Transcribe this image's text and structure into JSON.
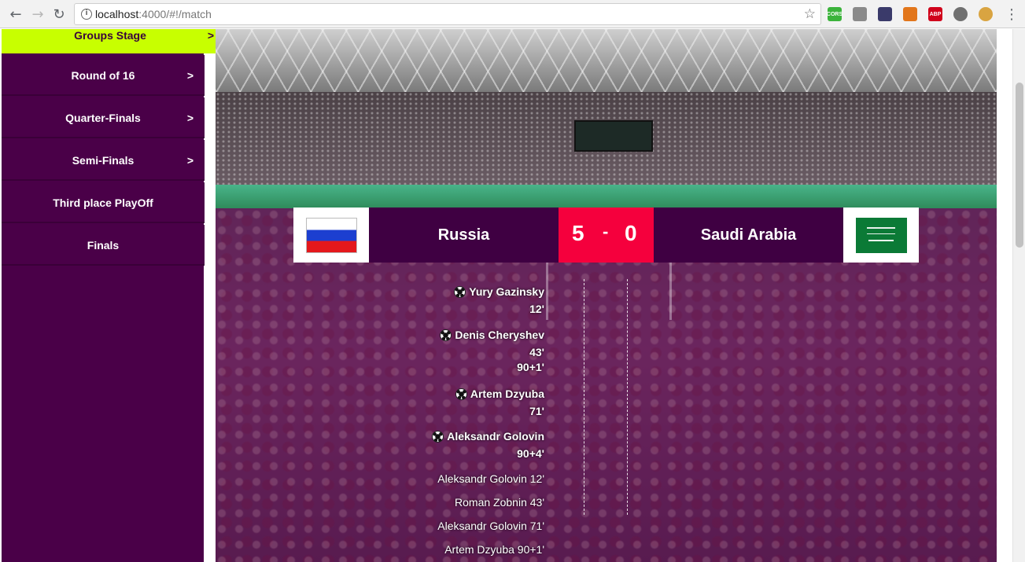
{
  "browser": {
    "url_host": "localhost",
    "url_path": ":4000/#!/match",
    "extensions": [
      {
        "name": "cors-icon",
        "text": "CORS",
        "color": "#3bb33b"
      },
      {
        "name": "screen-icon",
        "text": "",
        "color": "#8a8a8a"
      },
      {
        "name": "eyedropper-icon",
        "text": "",
        "color": "#3a3a6a"
      },
      {
        "name": "fox-icon",
        "text": "",
        "color": "#e2761b"
      },
      {
        "name": "adblock-icon",
        "text": "ABP",
        "color": "#d0021b"
      },
      {
        "name": "circle-extension-icon",
        "text": "",
        "color": "#707070"
      },
      {
        "name": "cookie-icon",
        "text": "",
        "color": "#d9a441"
      }
    ]
  },
  "sidebar": {
    "items": [
      {
        "label": "Groups Stage",
        "arrow": ">",
        "active": true
      },
      {
        "label": "Round of 16",
        "arrow": ">"
      },
      {
        "label": "Quarter-Finals",
        "arrow": ">"
      },
      {
        "label": "Semi-Finals",
        "arrow": ">"
      },
      {
        "label": "Third place PlayOff",
        "arrow": ""
      },
      {
        "label": "Finals",
        "arrow": ""
      }
    ]
  },
  "match": {
    "home_team": "Russia",
    "away_team": "Saudi Arabia",
    "home_score": "5",
    "separator": "-",
    "away_score": "0",
    "home_goals": [
      {
        "scorer": "Yury Gazinsky",
        "minutes": [
          "12'"
        ]
      },
      {
        "scorer": "Denis Cheryshev",
        "minutes": [
          "43'",
          "90+1'"
        ]
      },
      {
        "scorer": "Artem Dzyuba",
        "minutes": [
          "71'"
        ]
      },
      {
        "scorer": "Aleksandr Golovin",
        "minutes": [
          "90+4'"
        ]
      }
    ],
    "home_assists": [
      "Aleksandr Golovin 12'",
      "Roman Zobnin 43'",
      "Aleksandr Golovin 71'",
      "Artem Dzyuba 90+1'"
    ]
  },
  "colors": {
    "sidebar_bg": "#4a0048",
    "active_item": "#c8ff00",
    "team_bg": "#3f0042",
    "score_bg": "#f5003d"
  }
}
